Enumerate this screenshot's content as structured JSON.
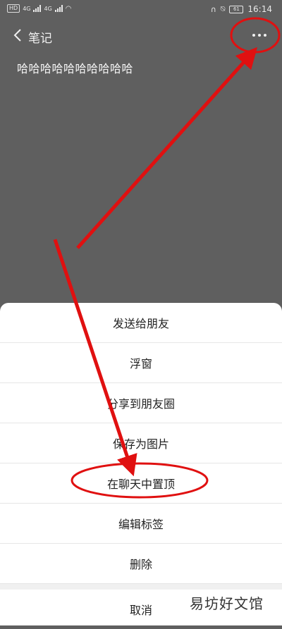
{
  "status_bar": {
    "left_badges": [
      "HD",
      "4G",
      "4G"
    ],
    "battery": "61",
    "time": "16:14",
    "icons": [
      "headphone-icon",
      "mute-bell-icon",
      "wifi-icon",
      "signal-icon",
      "battery-icon"
    ]
  },
  "header": {
    "title": "笔记",
    "back_icon": "chevron-left-icon",
    "more_icon": "more-dots-icon"
  },
  "note": {
    "content": "哈哈哈哈哈哈哈哈哈哈"
  },
  "menu": {
    "items": [
      "发送给朋友",
      "浮窗",
      "分享到朋友圈",
      "保存为图片",
      "在聊天中置顶",
      "编辑标签",
      "删除"
    ],
    "cancel": "取消"
  },
  "watermark": "易坊好文馆",
  "colors": {
    "background": "#5f5f5f",
    "sheet": "#ffffff",
    "annotation_red": "#e01010"
  }
}
